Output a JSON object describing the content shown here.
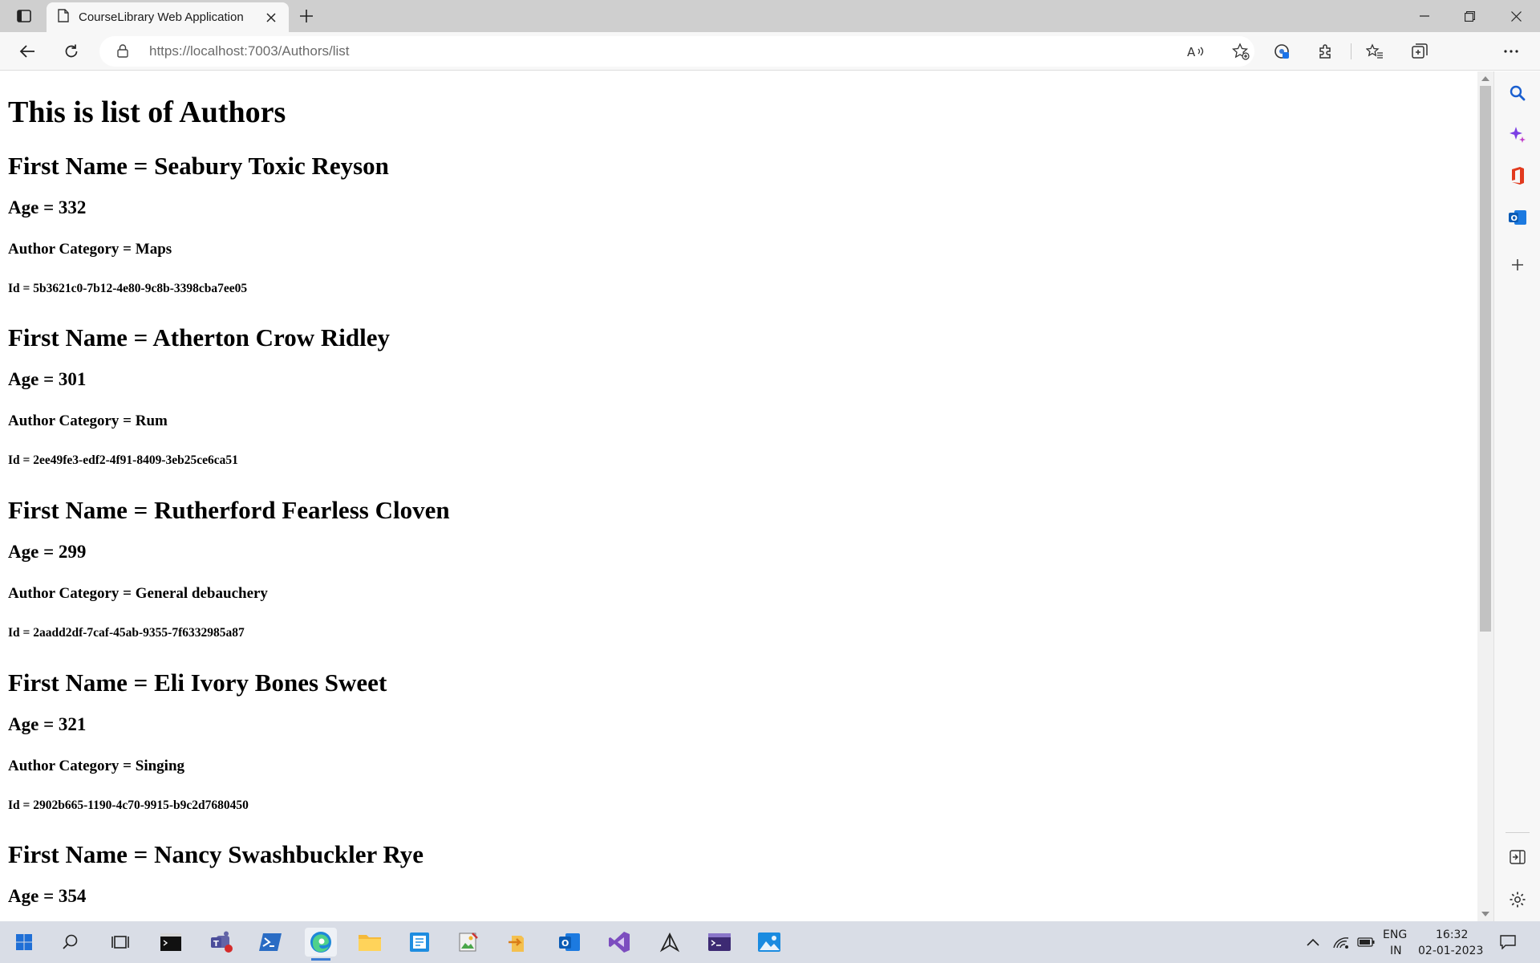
{
  "browser": {
    "tab_title": "CourseLibrary Web Application",
    "url_host": "https://localhost",
    "url_rest": ":7003/Authors/list"
  },
  "page": {
    "heading": "This is list of Authors",
    "authors": [
      {
        "first_name": "First Name = Seabury Toxic Reyson",
        "age": "Age = 332",
        "category": "Author Category = Maps",
        "id": "Id = 5b3621c0-7b12-4e80-9c8b-3398cba7ee05"
      },
      {
        "first_name": "First Name = Atherton Crow Ridley",
        "age": "Age = 301",
        "category": "Author Category = Rum",
        "id": "Id = 2ee49fe3-edf2-4f91-8409-3eb25ce6ca51"
      },
      {
        "first_name": "First Name = Rutherford Fearless Cloven",
        "age": "Age = 299",
        "category": "Author Category = General debauchery",
        "id": "Id = 2aadd2df-7caf-45ab-9355-7f6332985a87"
      },
      {
        "first_name": "First Name = Eli Ivory Bones Sweet",
        "age": "Age = 321",
        "category": "Author Category = Singing",
        "id": "Id = 2902b665-1190-4c70-9915-b9c2d7680450"
      },
      {
        "first_name": "First Name = Nancy Swashbuckler Rye",
        "age": "Age = 354",
        "category": "",
        "id": ""
      }
    ]
  },
  "taskbar": {
    "lang": "ENG",
    "region": "IN",
    "time": "16:32",
    "date": "02-01-2023"
  },
  "icons": {
    "titlebar": [
      "tab-actions-icon",
      "page-icon",
      "close-icon",
      "plus-icon",
      "minimize-icon",
      "restore-icon",
      "close-window-icon"
    ],
    "toolbar": [
      "back-icon",
      "refresh-icon",
      "lock-icon",
      "read-aloud-icon",
      "favorite-add-icon",
      "tracking-icon",
      "extensions-icon",
      "favorites-icon",
      "collections-icon",
      "more-icon"
    ],
    "sidebar": [
      "search-icon",
      "copilot-icon",
      "office-icon",
      "outlook-icon",
      "add-icon",
      "hide-sidebar-icon",
      "settings-icon"
    ]
  },
  "colors": {
    "accent": "#3a7bd5"
  }
}
